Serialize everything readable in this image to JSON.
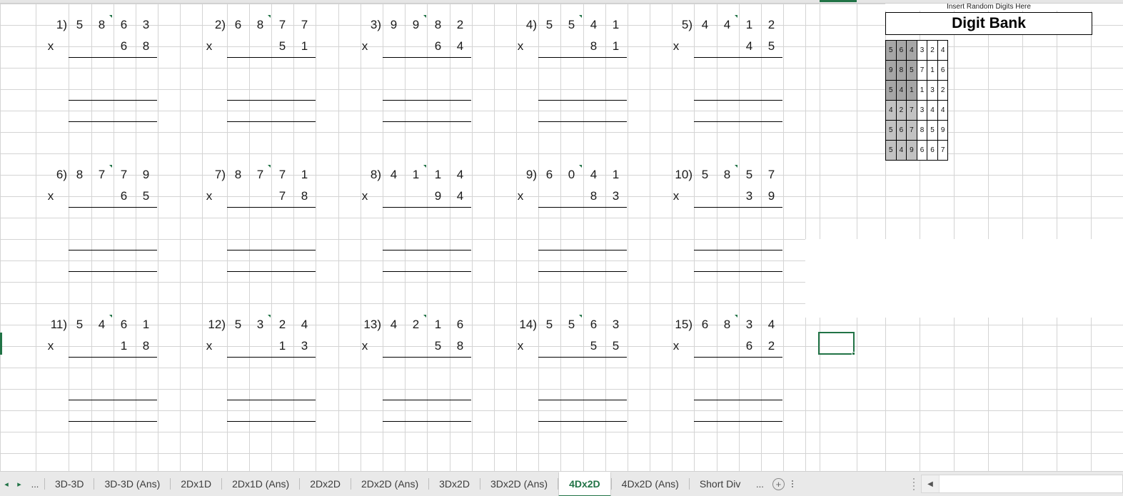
{
  "app": {
    "active_sheet": "4Dx2D",
    "accent_color": "#217346"
  },
  "digit_bank": {
    "caption": "Insert Random Digits Here",
    "title": "Digit Bank",
    "rows": [
      [
        "5",
        "6",
        "4",
        "3",
        "2",
        "4"
      ],
      [
        "9",
        "8",
        "5",
        "7",
        "1",
        "6"
      ],
      [
        "5",
        "4",
        "1",
        "1",
        "3",
        "2"
      ],
      [
        "4",
        "2",
        "7",
        "3",
        "4",
        "4"
      ],
      [
        "5",
        "6",
        "7",
        "8",
        "5",
        "9"
      ],
      [
        "5",
        "4",
        "9",
        "6",
        "6",
        "7"
      ]
    ],
    "shading": [
      [
        "dark",
        "dark",
        "dark",
        "plain",
        "plain",
        "plain"
      ],
      [
        "dark",
        "dark",
        "dark",
        "plain",
        "plain",
        "plain"
      ],
      [
        "dark",
        "dark",
        "dark",
        "plain",
        "plain",
        "plain"
      ],
      [
        "light",
        "light",
        "light",
        "plain",
        "plain",
        "plain"
      ],
      [
        "light",
        "light",
        "light",
        "plain",
        "plain",
        "plain"
      ],
      [
        "light",
        "light",
        "light",
        "plain",
        "plain",
        "plain"
      ]
    ],
    "shade_dark_hex": "#a6a6a6",
    "shade_light_hex": "#c2c2c2"
  },
  "worksheet": {
    "operator_symbol": "x",
    "problems": [
      {
        "label": "1)",
        "multiplicand": [
          "5",
          "8",
          "6",
          "3"
        ],
        "multiplier": [
          "",
          "",
          "6",
          "8"
        ]
      },
      {
        "label": "2)",
        "multiplicand": [
          "6",
          "8",
          "7",
          "7"
        ],
        "multiplier": [
          "",
          "",
          "5",
          "1"
        ]
      },
      {
        "label": "3)",
        "multiplicand": [
          "9",
          "9",
          "8",
          "2"
        ],
        "multiplier": [
          "",
          "",
          "6",
          "4"
        ]
      },
      {
        "label": "4)",
        "multiplicand": [
          "5",
          "5",
          "4",
          "1"
        ],
        "multiplier": [
          "",
          "",
          "8",
          "1"
        ]
      },
      {
        "label": "5)",
        "multiplicand": [
          "4",
          "4",
          "1",
          "2"
        ],
        "multiplier": [
          "",
          "",
          "4",
          "5"
        ]
      },
      {
        "label": "6)",
        "multiplicand": [
          "8",
          "7",
          "7",
          "9"
        ],
        "multiplier": [
          "",
          "",
          "6",
          "5"
        ]
      },
      {
        "label": "7)",
        "multiplicand": [
          "8",
          "7",
          "7",
          "1"
        ],
        "multiplier": [
          "",
          "",
          "7",
          "8"
        ]
      },
      {
        "label": "8)",
        "multiplicand": [
          "4",
          "1",
          "1",
          "4"
        ],
        "multiplier": [
          "",
          "",
          "9",
          "4"
        ]
      },
      {
        "label": "9)",
        "multiplicand": [
          "6",
          "0",
          "4",
          "1"
        ],
        "multiplier": [
          "",
          "",
          "8",
          "3"
        ]
      },
      {
        "label": "10)",
        "multiplicand": [
          "5",
          "8",
          "5",
          "7"
        ],
        "multiplier": [
          "",
          "",
          "3",
          "9"
        ]
      },
      {
        "label": "11)",
        "multiplicand": [
          "5",
          "4",
          "6",
          "1"
        ],
        "multiplier": [
          "",
          "",
          "1",
          "8"
        ]
      },
      {
        "label": "12)",
        "multiplicand": [
          "5",
          "3",
          "2",
          "4"
        ],
        "multiplier": [
          "",
          "",
          "1",
          "3"
        ]
      },
      {
        "label": "13)",
        "multiplicand": [
          "4",
          "2",
          "1",
          "6"
        ],
        "multiplier": [
          "",
          "",
          "5",
          "8"
        ]
      },
      {
        "label": "14)",
        "multiplicand": [
          "5",
          "5",
          "6",
          "3"
        ],
        "multiplier": [
          "",
          "",
          "5",
          "5"
        ]
      },
      {
        "label": "15)",
        "multiplicand": [
          "6",
          "8",
          "3",
          "4"
        ],
        "multiplier": [
          "",
          "",
          "6",
          "2"
        ]
      }
    ]
  },
  "tabbar": {
    "prev_arrow": "◂",
    "next_arrow": "▸",
    "left_ellipsis": "...",
    "right_ellipsis": "...",
    "add_sheet_glyph": "+",
    "tabs": [
      {
        "label": "3D-3D",
        "active": false
      },
      {
        "label": "3D-3D (Ans)",
        "active": false
      },
      {
        "label": "2Dx1D",
        "active": false
      },
      {
        "label": "2Dx1D (Ans)",
        "active": false
      },
      {
        "label": "2Dx2D",
        "active": false
      },
      {
        "label": "2Dx2D (Ans)",
        "active": false
      },
      {
        "label": "3Dx2D",
        "active": false
      },
      {
        "label": "3Dx2D (Ans)",
        "active": false
      },
      {
        "label": "4Dx2D",
        "active": true
      },
      {
        "label": "4Dx2D (Ans)",
        "active": false
      },
      {
        "label": "Short Div",
        "active": false
      }
    ],
    "scroll_left_glyph": "◀"
  }
}
